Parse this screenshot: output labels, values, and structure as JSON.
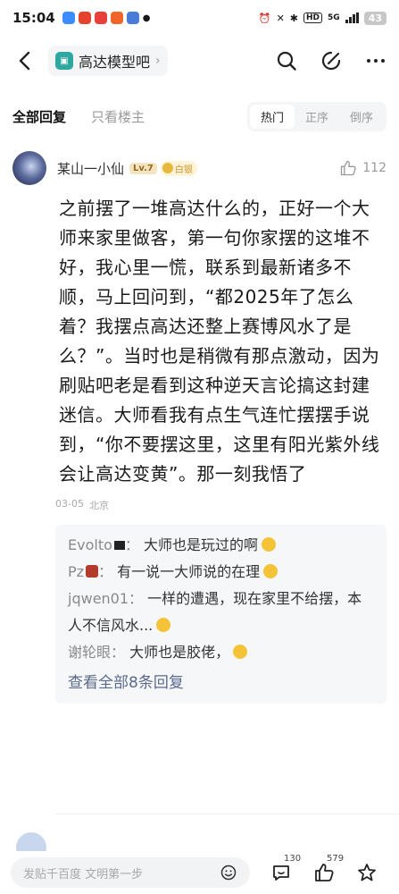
{
  "status_bar": {
    "time": "15:04",
    "network": "5G",
    "battery": "43",
    "hd_label": "HD"
  },
  "nav": {
    "forum_name": "高达模型吧"
  },
  "tabs": {
    "all_replies": "全部回复",
    "only_op": "只看楼主",
    "sort": [
      "热门",
      "正序",
      "倒序"
    ],
    "active_sort": "热门"
  },
  "post": {
    "author": "某山一小仙",
    "level": "Lv.7",
    "tier": "白银",
    "like_count": "112",
    "content": "之前摆了一堆高达什么的，正好一个大师来家里做客，第一句你家摆的这堆不好，我心里一慌，联系到最新诸多不顺，马上回问到，“都2025年了怎么着？我摆点高达还整上赛博风水了是么？”。当时也是稍微有那点激动，因为刷贴吧老是看到这种逆天言论搞这封建迷信。大师看我有点生气连忙摆摆手说到，“你不要摆这里，这里有阳光紫外线会让高达变黄”。那一刻我悟了",
    "date": "03-05",
    "location": "北京"
  },
  "replies": [
    {
      "user": "Evolto",
      "text": "大师也是玩过的啊"
    },
    {
      "user": "Pz",
      "text": "有一说一大师说的在理"
    },
    {
      "user": "jqwen01",
      "text": "一样的遭遇，现在家里不给摆，本人不信风水..."
    },
    {
      "user": "谢轮眼",
      "text": "大师也是胶佬，"
    }
  ],
  "view_all": "查看全部8条回复",
  "bottom_bar": {
    "input_placeholder": "发贴千百度 文明第一步",
    "comment_count": "130",
    "like_count": "579"
  }
}
